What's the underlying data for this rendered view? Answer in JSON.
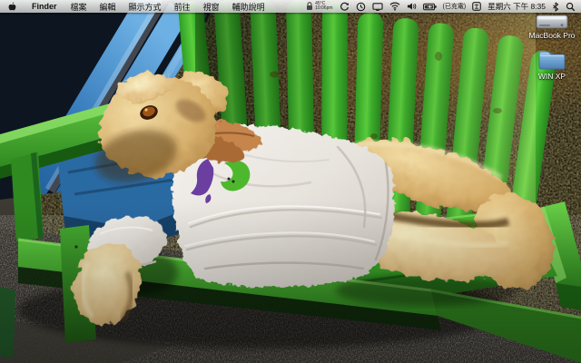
{
  "theme": {
    "menu_text_color": "#111111",
    "label_text_color": "#ffffff",
    "bench_green": "#3cb531",
    "bench_green_dark": "#1f7a16",
    "chair_blue": "#3a85c8",
    "bear_tan": "#d9b273",
    "shirt_white": "#eceae5",
    "shirt_logo_purple": "#6a3fa0",
    "shirt_logo_green": "#4db82e"
  },
  "menu_bar": {
    "app_name": "Finder",
    "menus": [
      {
        "label": "檔案"
      },
      {
        "label": "編輯"
      },
      {
        "label": "顯示方式"
      },
      {
        "label": "前往"
      },
      {
        "label": "視窗"
      },
      {
        "label": "輔助說明"
      }
    ],
    "status": {
      "widget_line1": "45°C",
      "widget_line2": "10:06pm",
      "battery_label": "(已充電)",
      "clock": "星期六 下午 8:35"
    }
  },
  "desktop": {
    "icons": [
      {
        "label": "MacBook Pro",
        "kind": "internal-hard-drive"
      },
      {
        "label": "WIN XP",
        "kind": "blue-folder"
      }
    ],
    "wallpaper_description": "Giant teddy bear in a white t-shirt lying on a bright green wooden garden bench beside a blue wooden chair, dark grass behind and asphalt below"
  }
}
